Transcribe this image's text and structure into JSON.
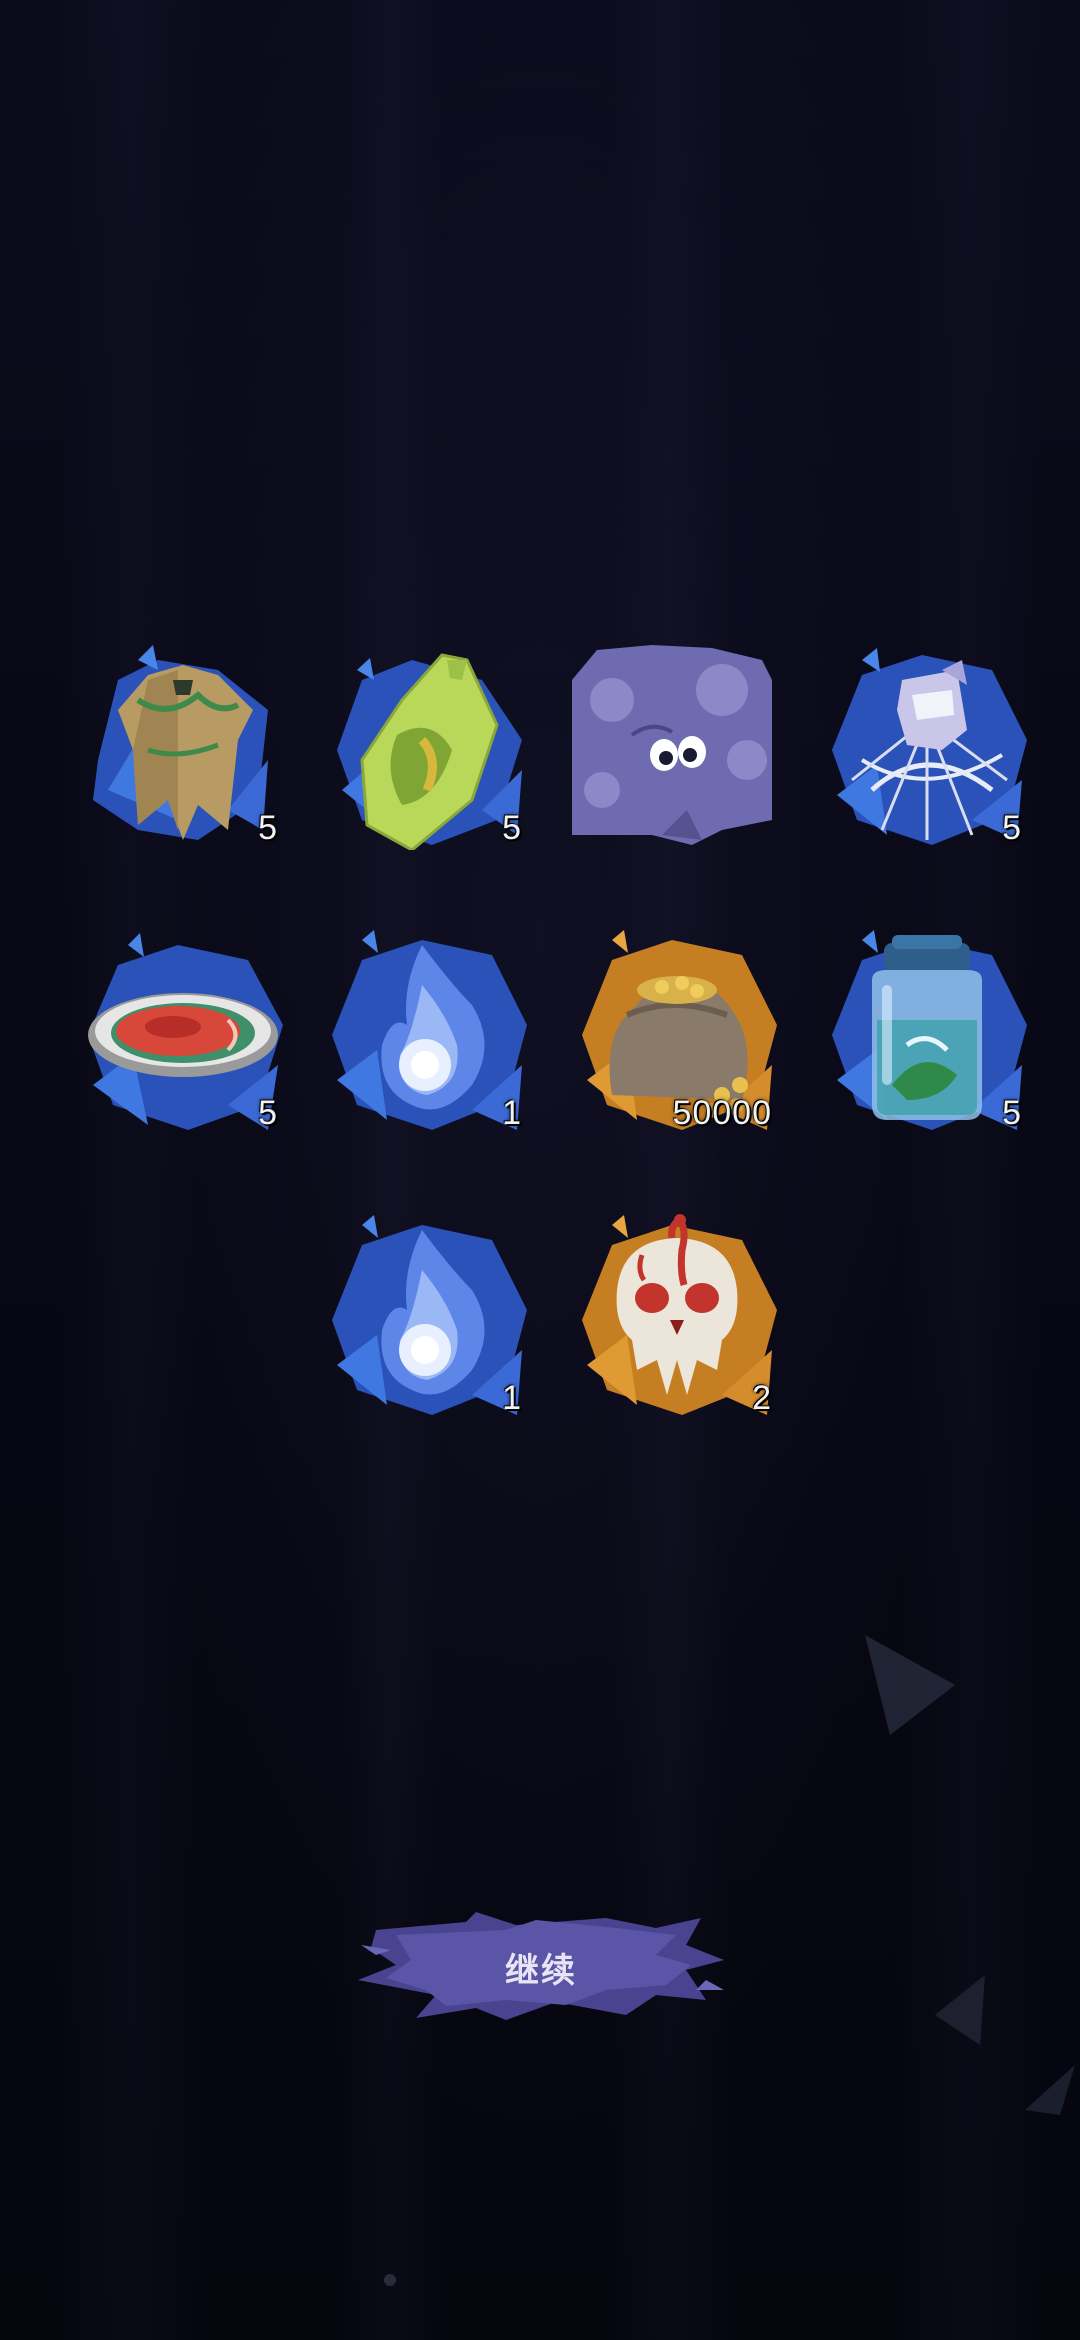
{
  "rewards": [
    {
      "icon": "tattered-robe-icon",
      "count": "5",
      "frame": "blue"
    },
    {
      "icon": "green-leaf-pouch-icon",
      "count": "5",
      "frame": "blue"
    },
    {
      "icon": "purple-mushroom-creature-icon",
      "count": "",
      "frame": "none"
    },
    {
      "icon": "cobweb-cloth-icon",
      "count": "5",
      "frame": "blue"
    },
    {
      "icon": "raw-meat-dish-icon",
      "count": "5",
      "frame": "blue"
    },
    {
      "icon": "blue-soul-flame-icon",
      "count": "1",
      "frame": "blue"
    },
    {
      "icon": "gold-coin-sack-icon",
      "count": "50000",
      "frame": "orange"
    },
    {
      "icon": "specimen-jar-icon",
      "count": "5",
      "frame": "blue"
    },
    {
      "icon": "blue-soul-flame-icon",
      "count": "1",
      "frame": "blue"
    },
    {
      "icon": "bloody-skull-icon",
      "count": "2",
      "frame": "orange"
    }
  ],
  "continue_button": {
    "label": "继续"
  },
  "colors": {
    "frame_blue": "#2f5cc4",
    "frame_orange": "#d08a28",
    "button": "#4a4490"
  }
}
